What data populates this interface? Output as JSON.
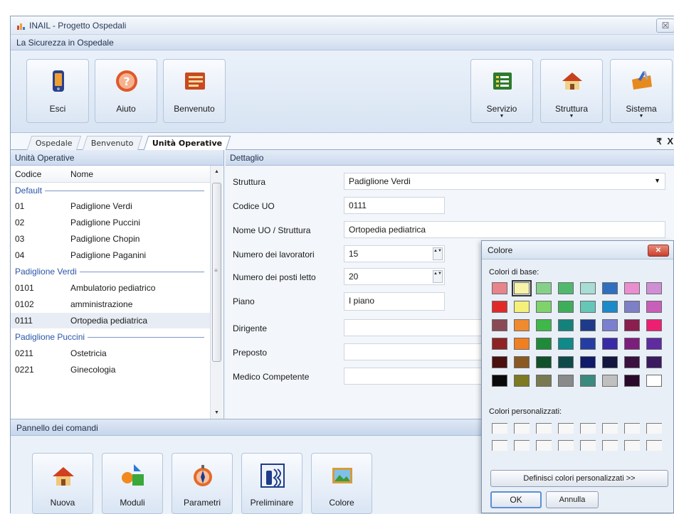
{
  "window": {
    "title": "INAIL - Progetto Ospedali",
    "close_glyph": "☒"
  },
  "ribbon": {
    "title": "La Sicurezza in Ospedale",
    "left_buttons": [
      {
        "label": "Esci",
        "icon": "exit-phone-icon"
      },
      {
        "label": "Aiuto",
        "icon": "help-icon"
      },
      {
        "label": "Benvenuto",
        "icon": "welcome-board-icon"
      }
    ],
    "right_buttons": [
      {
        "label": "Servizio",
        "icon": "service-list-icon",
        "arrow": "▼"
      },
      {
        "label": "Struttura",
        "icon": "house-icon",
        "arrow": "▼"
      },
      {
        "label": "Sistema",
        "icon": "system-toolbox-icon",
        "arrow": "▼"
      }
    ]
  },
  "tabs": {
    "items": [
      {
        "label": "Ospedale",
        "active": false
      },
      {
        "label": "Benvenuto",
        "active": false
      },
      {
        "label": "Unità Operative",
        "active": true
      }
    ],
    "menu_glyph": "₹",
    "close_glyph": "X"
  },
  "left_panel": {
    "title": "Unità Operative",
    "columns": {
      "code": "Codice",
      "name": "Nome"
    },
    "groups": [
      {
        "name": "Default",
        "rows": [
          {
            "code": "01",
            "name": "Padiglione Verdi"
          },
          {
            "code": "02",
            "name": "Padiglione Puccini"
          },
          {
            "code": "03",
            "name": "Padiglione Chopin"
          },
          {
            "code": "04",
            "name": "Padiglione Paganini"
          }
        ]
      },
      {
        "name": "Padiglione Verdi",
        "rows": [
          {
            "code": "0101",
            "name": "Ambulatorio pediatrico"
          },
          {
            "code": "0102",
            "name": "amministrazione"
          },
          {
            "code": "0111",
            "name": "Ortopedia pediatrica",
            "selected": true
          }
        ]
      },
      {
        "name": "Padiglione Puccini",
        "rows": [
          {
            "code": "0211",
            "name": "Ostetricia"
          },
          {
            "code": "0221",
            "name": "Ginecologia"
          }
        ]
      }
    ],
    "scroll_up": "▲",
    "scroll_down": "▼",
    "scroll_grip": "≡"
  },
  "detail": {
    "title": "Dettaglio",
    "struttura_label": "Struttura",
    "struttura_value": "Padiglione Verdi",
    "combo_arrow": "▼",
    "codice_label": "Codice UO",
    "codice_value": "0111",
    "nome_label": "Nome UO / Struttura",
    "nome_value": "Ortopedia pediatrica",
    "lavoratori_label": "Numero dei lavoratori",
    "lavoratori_value": "15",
    "posti_label": "Numero dei posti letto",
    "posti_value": "20",
    "spin_glyph": "▲▼",
    "piano_label": "Piano",
    "piano_value": "I piano",
    "dirigente_label": "Dirigente",
    "preposto_label": "Preposto",
    "medico_label": "Medico Competente"
  },
  "bottom_panel": {
    "title": "Pannello dei comandi",
    "buttons": [
      {
        "label": "Nuova",
        "icon": "new-house-icon"
      },
      {
        "label": "Moduli",
        "icon": "modules-shapes-icon"
      },
      {
        "label": "Parametri",
        "icon": "parameters-compass-icon"
      },
      {
        "label": "Preliminare",
        "icon": "preliminary-extinguisher-icon"
      },
      {
        "label": "Colore",
        "icon": "color-picture-icon"
      }
    ]
  },
  "color_dialog": {
    "title": "Colore",
    "close_glyph": "✕",
    "base_label": "Colori di base:",
    "custom_label": "Colori personalizzati:",
    "define_button": "Definisci colori personalizzati >>",
    "ok_button": "OK",
    "cancel_button": "Annulla",
    "selected_index": 1,
    "base_colors": [
      "#e8848c",
      "#f7f3a8",
      "#86d18a",
      "#51b96e",
      "#a7ddd4",
      "#2f6fbf",
      "#e98fd0",
      "#d08fd4",
      "#e02a2a",
      "#f4f07a",
      "#7ed36b",
      "#3fae5a",
      "#66c6b8",
      "#1c89c9",
      "#7d7fc7",
      "#c85fb8",
      "#8a4a55",
      "#f08a2e",
      "#3fb84a",
      "#14827a",
      "#1d3b8a",
      "#7a7fcf",
      "#8a1e4e",
      "#ee1f72",
      "#8d2323",
      "#f07f22",
      "#1f8a3a",
      "#0f8a8a",
      "#243da3",
      "#3a2aa8",
      "#7d1e7d",
      "#5e2ba0",
      "#4a1010",
      "#8a5a22",
      "#10502a",
      "#0d4a4a",
      "#101a6a",
      "#121640",
      "#3a1040",
      "#3a1a60",
      "#0a0a0a",
      "#7d7a22",
      "#7a7a50",
      "#8a8a8a",
      "#3a8a80",
      "#c0c0c0",
      "#2a0a2a",
      "#ffffff"
    ]
  }
}
